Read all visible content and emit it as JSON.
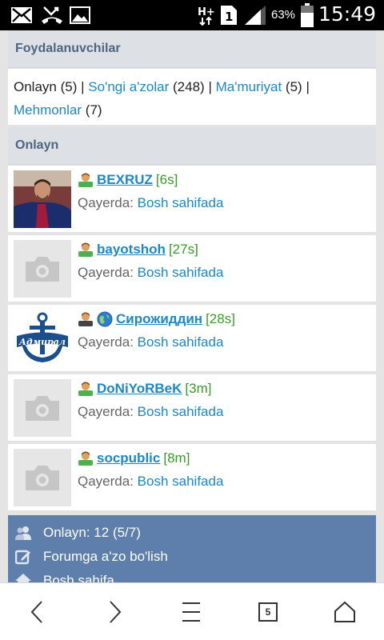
{
  "status_bar": {
    "battery_percent": "63%",
    "time": "15:49",
    "sim_slot": "1",
    "network": "H+",
    "icons": [
      "mail-icon",
      "missed-call-icon",
      "image-icon",
      "network-hplus-icon",
      "sim-1-icon",
      "signal-icon",
      "battery-icon"
    ]
  },
  "users_section": {
    "title": "Foydalanuvchilar",
    "online_label": "Onlayn",
    "online_count": "(5)",
    "sep": "|",
    "recent_label": "So'ngi a'zolar",
    "recent_count": "(248)",
    "admin_label": "Ma'muriyat",
    "admin_count": "(5)",
    "guests_label": "Mehmonlar",
    "guests_count": "(7)"
  },
  "online_section": {
    "title": "Onlayn",
    "where_label": "Qayerda:",
    "users": [
      {
        "name": "BEXRUZ",
        "time": "[6s]",
        "location": "Bosh sahifada",
        "avatar": "photo"
      },
      {
        "name": "bayotshoh",
        "time": "[27s]",
        "location": "Bosh sahifada",
        "avatar": "placeholder"
      },
      {
        "name": "Сирожиддин",
        "time": "[28s]",
        "location": "Bosh sahifada",
        "avatar": "logo"
      },
      {
        "name": "DoNiYoRBeK",
        "time": "[3m]",
        "location": "Bosh sahifada",
        "avatar": "placeholder"
      },
      {
        "name": "socpublic",
        "time": "[8m]",
        "location": "Bosh sahifada",
        "avatar": "placeholder"
      }
    ]
  },
  "footer_menu": {
    "online_stats": "Onlayn: 12 (5/7)",
    "join_forum": "Forumga a'zo bo'lish",
    "home": "Bosh sahifa"
  },
  "bottom_nav": {
    "tabs_count": "5"
  },
  "colors": {
    "link": "#1a88c9",
    "time_green": "#3a9a2a",
    "header_bg": "#dde0e5",
    "header_text": "#4d6680",
    "footer_bg": "#5e7fab"
  }
}
